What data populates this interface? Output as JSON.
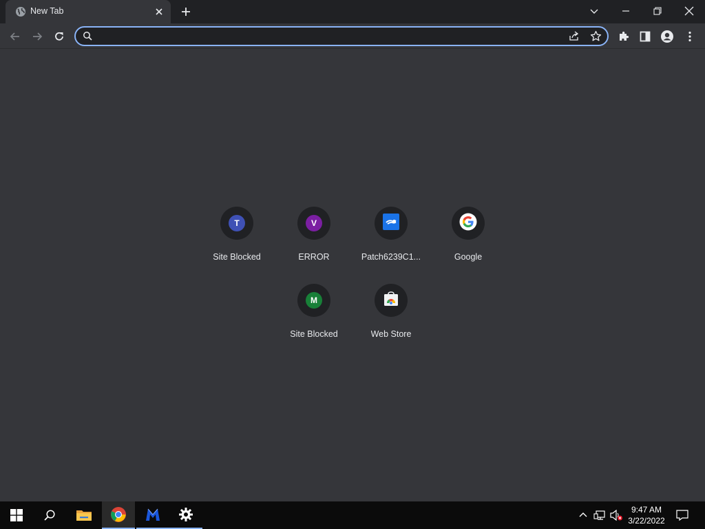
{
  "browser": {
    "tab": {
      "title": "New Tab",
      "favicon": "globe-icon",
      "close_icon": "close-icon"
    },
    "new_tab_icon": "plus-icon",
    "window_controls": [
      "chevron-down-icon",
      "minimize-icon",
      "restore-icon",
      "close-icon"
    ]
  },
  "toolbar": {
    "back_icon": "arrow-left-icon",
    "forward_icon": "arrow-right-icon",
    "reload_icon": "reload-icon",
    "omnibox": {
      "value": "",
      "placeholder": "",
      "search_icon": "search-icon",
      "share_icon": "share-icon",
      "bookmark_icon": "star-icon"
    },
    "extensions_icon": "puzzle-icon",
    "side_panel_icon": "side-panel-icon",
    "profile_icon": "person-icon",
    "menu_icon": "kebab-menu-icon"
  },
  "shortcuts": [
    {
      "label": "Site Blocked",
      "icon_type": "letter",
      "letter": "T",
      "color": "#3f51b5"
    },
    {
      "label": "ERROR",
      "icon_type": "letter",
      "letter": "V",
      "color": "#7b1fa2"
    },
    {
      "label": "Patch6239C1...",
      "icon_type": "favicon",
      "icon": "patch-site-icon",
      "color": "#1a73e8"
    },
    {
      "label": "Google",
      "icon_type": "favicon",
      "icon": "google-g-icon",
      "color": "#ffffff"
    },
    {
      "label": "Site Blocked",
      "icon_type": "letter",
      "letter": "M",
      "color": "#188038"
    },
    {
      "label": "Web Store",
      "icon_type": "favicon",
      "icon": "web-store-icon",
      "color": "#f1f3f4"
    }
  ],
  "taskbar": {
    "start_icon": "windows-start-icon",
    "search_icon": "search-icon",
    "apps": [
      {
        "name": "file-explorer-icon",
        "state": "normal"
      },
      {
        "name": "chrome-icon",
        "state": "active"
      },
      {
        "name": "malwarebytes-icon",
        "state": "running"
      },
      {
        "name": "settings-gear-icon",
        "state": "running"
      }
    ],
    "tray": {
      "icons": [
        "chevron-up-icon",
        "network-icon",
        "volume-muted-icon"
      ],
      "time": "9:47 AM",
      "date": "3/22/2022",
      "notification_icon": "notification-icon"
    }
  },
  "colors": {
    "tab_strip": "#202124",
    "toolbar": "#35363a",
    "page_bg": "#35363a",
    "accent": "#8ab4f8",
    "text": "#e8eaed"
  }
}
